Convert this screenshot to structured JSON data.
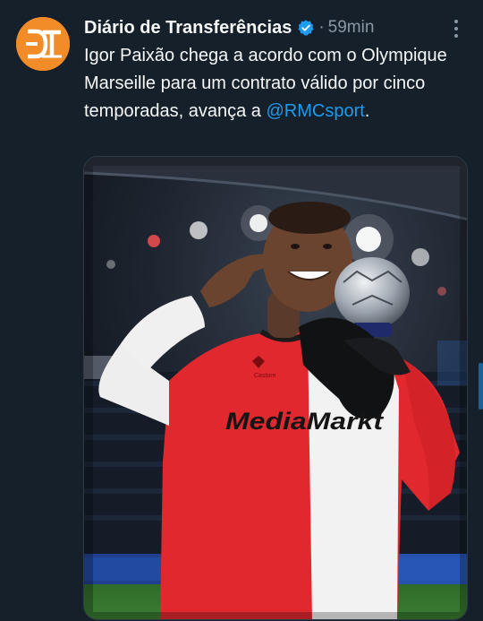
{
  "tweet": {
    "author_name": "Diário de Transferências",
    "separator": "·",
    "time": "59min",
    "text_before_mention": "Igor Paixão chega a acordo com o Olympique Marseille para um contrato válido por cinco temporadas, avança a ",
    "mention": "@RMCsport",
    "text_after_mention": ".",
    "avatar_monogram": "DT",
    "media_shirt_sponsor": "MediaMarkt",
    "media_shirt_maker": "Castore"
  },
  "icons": {
    "verified": "verified-badge-icon",
    "more": "more-options-icon"
  },
  "colors": {
    "background": "#15202b",
    "text_primary": "#f7f9f9",
    "text_secondary": "#8b98a5",
    "link": "#1d9bf0",
    "avatar_bg": "#f28c28",
    "shirt_red": "#e0282e",
    "shirt_white": "#f2f2f2"
  }
}
